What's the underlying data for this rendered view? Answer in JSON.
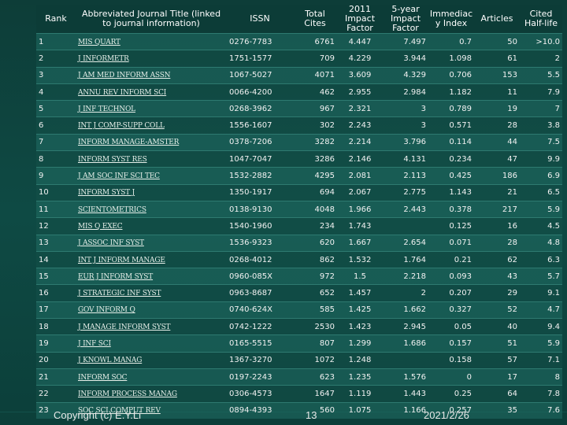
{
  "headers": {
    "rank": "Rank",
    "title": "Abbreviated Journal Title (linked to journal information)",
    "issn": "ISSN",
    "total_cites": "Total Cites",
    "impact_factor": "2011 Impact Factor",
    "five_year": "5-year Impact Factor",
    "immediacy": "Immediac y Index",
    "articles": "Articles",
    "half_life": "Cited Half-life"
  },
  "rows": [
    {
      "rank": "1",
      "title": "MIS QUART",
      "issn": "0276-7783",
      "total_cites": "6761",
      "jif": "4.447",
      "five_year": "7.497",
      "immediacy": "0.7",
      "articles": "50",
      "half_life": ">10.0"
    },
    {
      "rank": "2",
      "title": "J INFORMETR",
      "issn": "1751-1577",
      "total_cites": "709",
      "jif": "4.229",
      "five_year": "3.944",
      "immediacy": "1.098",
      "articles": "61",
      "half_life": "2"
    },
    {
      "rank": "3",
      "title": "J AM MED INFORM ASSN",
      "issn": "1067-5027",
      "total_cites": "4071",
      "jif": "3.609",
      "five_year": "4.329",
      "immediacy": "0.706",
      "articles": "153",
      "half_life": "5.5"
    },
    {
      "rank": "4",
      "title": "ANNU REV INFORM SCI",
      "issn": "0066-4200",
      "total_cites": "462",
      "jif": "2.955",
      "five_year": "2.984",
      "immediacy": "1.182",
      "articles": "11",
      "half_life": "7.9"
    },
    {
      "rank": "5",
      "title": "J INF TECHNOL",
      "issn": "0268-3962",
      "total_cites": "967",
      "jif": "2.321",
      "five_year": "3",
      "immediacy": "0.789",
      "articles": "19",
      "half_life": "7"
    },
    {
      "rank": "6",
      "title": "INT J COMP-SUPP COLL",
      "issn": "1556-1607",
      "total_cites": "302",
      "jif": "2.243",
      "five_year": "3",
      "immediacy": "0.571",
      "articles": "28",
      "half_life": "3.8"
    },
    {
      "rank": "7",
      "title": "INFORM MANAGE-AMSTER",
      "issn": "0378-7206",
      "total_cites": "3282",
      "jif": "2.214",
      "five_year": "3.796",
      "immediacy": "0.114",
      "articles": "44",
      "half_life": "7.5"
    },
    {
      "rank": "8",
      "title": "INFORM SYST RES",
      "issn": "1047-7047",
      "total_cites": "3286",
      "jif": "2.146",
      "five_year": "4.131",
      "immediacy": "0.234",
      "articles": "47",
      "half_life": "9.9"
    },
    {
      "rank": "9",
      "title": "J AM SOC INF SCI TEC",
      "issn": "1532-2882",
      "total_cites": "4295",
      "jif": "2.081",
      "five_year": "2.113",
      "immediacy": "0.425",
      "articles": "186",
      "half_life": "6.9"
    },
    {
      "rank": "10",
      "title": "INFORM SYST J",
      "issn": "1350-1917",
      "total_cites": "694",
      "jif": "2.067",
      "five_year": "2.775",
      "immediacy": "1.143",
      "articles": "21",
      "half_life": "6.5"
    },
    {
      "rank": "11",
      "title": "SCIENTOMETRICS",
      "issn": "0138-9130",
      "total_cites": "4048",
      "jif": "1.966",
      "five_year": "2.443",
      "immediacy": "0.378",
      "articles": "217",
      "half_life": "5.9"
    },
    {
      "rank": "12",
      "title": "MIS Q EXEC",
      "issn": "1540-1960",
      "total_cites": "234",
      "jif": "1.743",
      "five_year": "",
      "immediacy": "0.125",
      "articles": "16",
      "half_life": "4.5"
    },
    {
      "rank": "13",
      "title": "J ASSOC INF SYST",
      "issn": "1536-9323",
      "total_cites": "620",
      "jif": "1.667",
      "five_year": "2.654",
      "immediacy": "0.071",
      "articles": "28",
      "half_life": "4.8"
    },
    {
      "rank": "14",
      "title": "INT J INFORM MANAGE",
      "issn": "0268-4012",
      "total_cites": "862",
      "jif": "1.532",
      "five_year": "1.764",
      "immediacy": "0.21",
      "articles": "62",
      "half_life": "6.3"
    },
    {
      "rank": "15",
      "title": "EUR J INFORM SYST",
      "issn": "0960-085X",
      "total_cites": "972",
      "jif": "1.5",
      "five_year": "2.218",
      "immediacy": "0.093",
      "articles": "43",
      "half_life": "5.7"
    },
    {
      "rank": "16",
      "title": "J STRATEGIC INF SYST",
      "issn": "0963-8687",
      "total_cites": "652",
      "jif": "1.457",
      "five_year": "2",
      "immediacy": "0.207",
      "articles": "29",
      "half_life": "9.1"
    },
    {
      "rank": "17",
      "title": "GOV INFORM Q",
      "issn": "0740-624X",
      "total_cites": "585",
      "jif": "1.425",
      "five_year": "1.662",
      "immediacy": "0.327",
      "articles": "52",
      "half_life": "4.7"
    },
    {
      "rank": "18",
      "title": "J MANAGE INFORM SYST",
      "issn": "0742-1222",
      "total_cites": "2530",
      "jif": "1.423",
      "five_year": "2.945",
      "immediacy": "0.05",
      "articles": "40",
      "half_life": "9.4"
    },
    {
      "rank": "19",
      "title": "J INF SCI",
      "issn": "0165-5515",
      "total_cites": "807",
      "jif": "1.299",
      "five_year": "1.686",
      "immediacy": "0.157",
      "articles": "51",
      "half_life": "5.9"
    },
    {
      "rank": "20",
      "title": "J KNOWL MANAG",
      "issn": "1367-3270",
      "total_cites": "1072",
      "jif": "1.248",
      "five_year": "",
      "immediacy": "0.158",
      "articles": "57",
      "half_life": "7.1"
    },
    {
      "rank": "21",
      "title": "INFORM SOC",
      "issn": "0197-2243",
      "total_cites": "623",
      "jif": "1.235",
      "five_year": "1.576",
      "immediacy": "0",
      "articles": "17",
      "half_life": "8"
    },
    {
      "rank": "22",
      "title": "INFORM PROCESS MANAG",
      "issn": "0306-4573",
      "total_cites": "1647",
      "jif": "1.119",
      "five_year": "1.443",
      "immediacy": "0.25",
      "articles": "64",
      "half_life": "7.8"
    },
    {
      "rank": "23",
      "title": "SOC SCI COMPUT REV",
      "issn": "0894-4393",
      "total_cites": "560",
      "jif": "1.075",
      "five_year": "1.166",
      "immediacy": "0.257",
      "articles": "35",
      "half_life": "7.6"
    }
  ],
  "footer": {
    "copyright": "Copyright (c) E.Y.Li",
    "page": "13",
    "date": "2021/2/26"
  }
}
